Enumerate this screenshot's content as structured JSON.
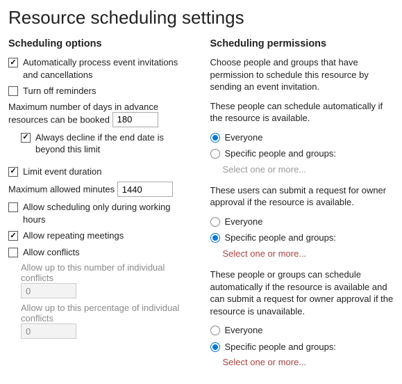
{
  "title": "Resource scheduling settings",
  "left": {
    "heading": "Scheduling options",
    "autoProcess": {
      "label": "Automatically process event invitations and cancellations",
      "checked": true
    },
    "turnOffReminders": {
      "label": "Turn off reminders",
      "checked": false
    },
    "maxDays": {
      "label": "Maximum number of days in advance resources can be booked",
      "value": "180"
    },
    "declineBeyond": {
      "label": "Always decline if the end date is beyond this limit",
      "checked": true
    },
    "limitDuration": {
      "label": "Limit event duration",
      "checked": true
    },
    "maxMinutes": {
      "label": "Maximum allowed minutes",
      "value": "1440"
    },
    "workingHoursOnly": {
      "label": "Allow scheduling only during working hours",
      "checked": false
    },
    "allowRepeating": {
      "label": "Allow repeating meetings",
      "checked": true
    },
    "allowConflicts": {
      "label": "Allow conflicts",
      "checked": false
    },
    "conflictCount": {
      "label": "Allow up to this number of individual conflicts",
      "value": "0"
    },
    "conflictPct": {
      "label": "Allow up to this percentage of individual conflicts",
      "value": "0"
    }
  },
  "right": {
    "heading": "Scheduling permissions",
    "intro": "Choose people and groups that have permission to schedule this resource by sending an event invitation.",
    "autoBook": {
      "desc": "These people can schedule automatically if the resource is available.",
      "everyone": "Everyone",
      "specific": "Specific people and groups:",
      "selected": "everyone",
      "picker": "Select one or more..."
    },
    "submitRequest": {
      "desc": "These users can submit a request for owner approval if the resource is available.",
      "everyone": "Everyone",
      "specific": "Specific people and groups:",
      "selected": "specific",
      "picker": "Select one or more..."
    },
    "both": {
      "desc": "These people or groups can schedule automatically if the resource is available and can submit a request for owner approval if the resource is unavailable.",
      "everyone": "Everyone",
      "specific": "Specific people and groups:",
      "selected": "specific",
      "picker": "Select one or more..."
    }
  }
}
